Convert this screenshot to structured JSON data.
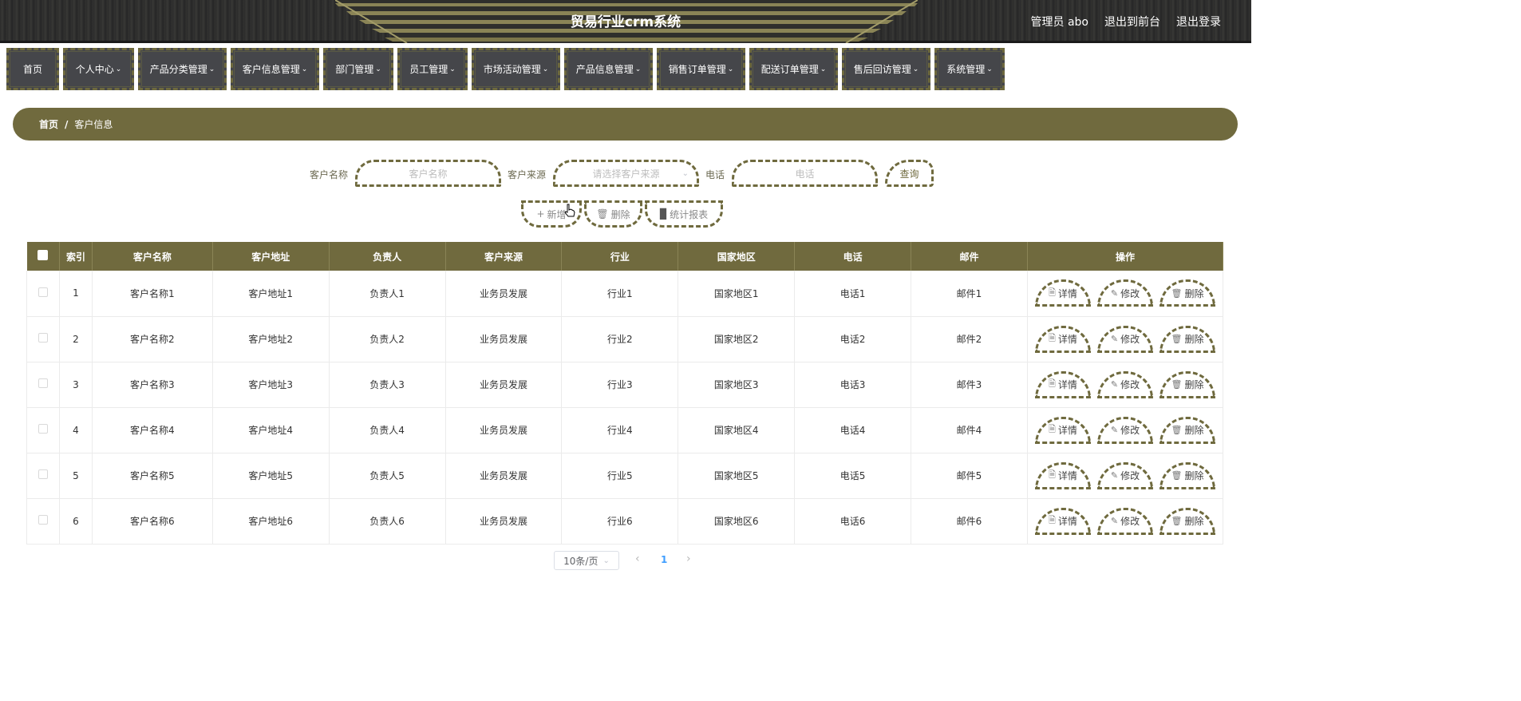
{
  "header": {
    "title": "贸易行业crm系统",
    "user_label": "管理员 abo",
    "front_link": "退出到前台",
    "logout_link": "退出登录"
  },
  "nav": [
    {
      "label": "首页",
      "dropdown": false
    },
    {
      "label": "个人中心",
      "dropdown": true
    },
    {
      "label": "产品分类管理",
      "dropdown": true
    },
    {
      "label": "客户信息管理",
      "dropdown": true
    },
    {
      "label": "部门管理",
      "dropdown": true
    },
    {
      "label": "员工管理",
      "dropdown": true
    },
    {
      "label": "市场活动管理",
      "dropdown": true
    },
    {
      "label": "产品信息管理",
      "dropdown": true
    },
    {
      "label": "销售订单管理",
      "dropdown": true
    },
    {
      "label": "配送订单管理",
      "dropdown": true
    },
    {
      "label": "售后回访管理",
      "dropdown": true
    },
    {
      "label": "系统管理",
      "dropdown": true
    }
  ],
  "breadcrumb": {
    "home": "首页",
    "separator": "/",
    "current": "客户信息"
  },
  "search": {
    "name_label": "客户名称",
    "name_placeholder": "客户名称",
    "source_label": "客户来源",
    "source_placeholder": "请选择客户来源",
    "phone_label": "电话",
    "phone_placeholder": "电话",
    "query_button": "查询"
  },
  "actions": {
    "add": "新增",
    "delete": "删除",
    "report": "统计报表"
  },
  "table": {
    "headers": [
      "索引",
      "客户名称",
      "客户地址",
      "负责人",
      "客户来源",
      "行业",
      "国家地区",
      "电话",
      "邮件",
      "操作"
    ],
    "rows": [
      [
        "1",
        "客户名称1",
        "客户地址1",
        "负责人1",
        "业务员发展",
        "行业1",
        "国家地区1",
        "电话1",
        "邮件1"
      ],
      [
        "2",
        "客户名称2",
        "客户地址2",
        "负责人2",
        "业务员发展",
        "行业2",
        "国家地区2",
        "电话2",
        "邮件2"
      ],
      [
        "3",
        "客户名称3",
        "客户地址3",
        "负责人3",
        "业务员发展",
        "行业3",
        "国家地区3",
        "电话3",
        "邮件3"
      ],
      [
        "4",
        "客户名称4",
        "客户地址4",
        "负责人4",
        "业务员发展",
        "行业4",
        "国家地区4",
        "电话4",
        "邮件4"
      ],
      [
        "5",
        "客户名称5",
        "客户地址5",
        "负责人5",
        "业务员发展",
        "行业5",
        "国家地区5",
        "电话5",
        "邮件5"
      ],
      [
        "6",
        "客户名称6",
        "客户地址6",
        "负责人6",
        "业务员发展",
        "行业6",
        "国家地区6",
        "电话6",
        "邮件6"
      ]
    ],
    "row_actions": {
      "detail": "详情",
      "edit": "修改",
      "delete": "删除"
    }
  },
  "pagination": {
    "page_size": "10条/页",
    "current_page": "1"
  },
  "colors": {
    "accent": "#706a3e",
    "header_bg": "#2b2b2b",
    "nav_bg": "#45464a",
    "page_active": "#409eff"
  }
}
